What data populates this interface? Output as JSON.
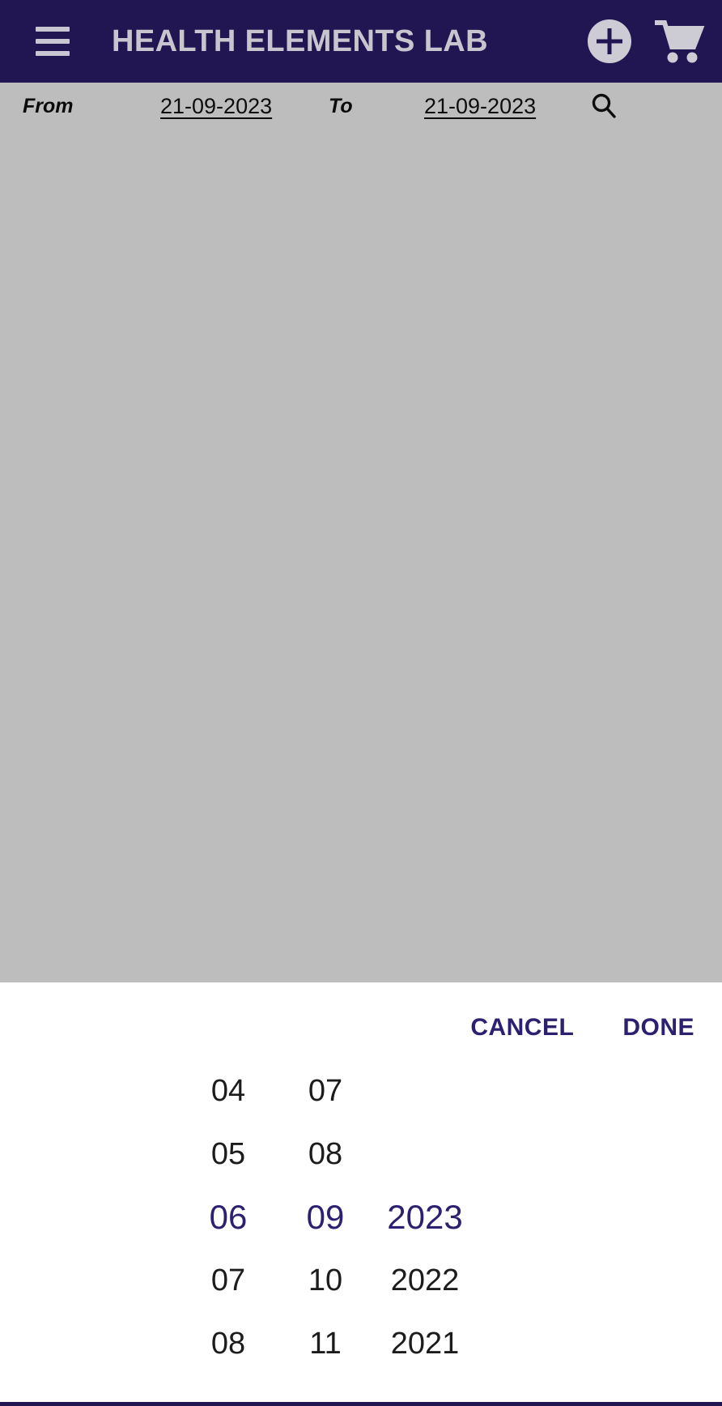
{
  "app_bar": {
    "menu_icon": "hamburger-menu-icon",
    "title": "HEALTH ELEMENTS LAB",
    "add_icon": "add-circle-icon",
    "cart_icon": "shopping-cart-icon",
    "background_color": "#211552",
    "title_color": "#c7c5ce"
  },
  "filter_bar": {
    "from_label": "From",
    "from_date": "21-09-2023",
    "to_label": "To",
    "to_date": "21-09-2023",
    "search_icon": "search-icon",
    "background_color": "#bdbdbd"
  },
  "content": {
    "background_color": "#bdbdbd"
  },
  "date_picker": {
    "cancel_label": "CANCEL",
    "done_label": "DONE",
    "accent_color": "#2c2070",
    "selected_day": "06",
    "selected_month": "09",
    "selected_year": "2023",
    "day_column": [
      "04",
      "05",
      "06",
      "07",
      "08"
    ],
    "month_column": [
      "07",
      "08",
      "09",
      "10",
      "11"
    ],
    "year_column": [
      "",
      "",
      "2023",
      "2022",
      "2021"
    ]
  }
}
